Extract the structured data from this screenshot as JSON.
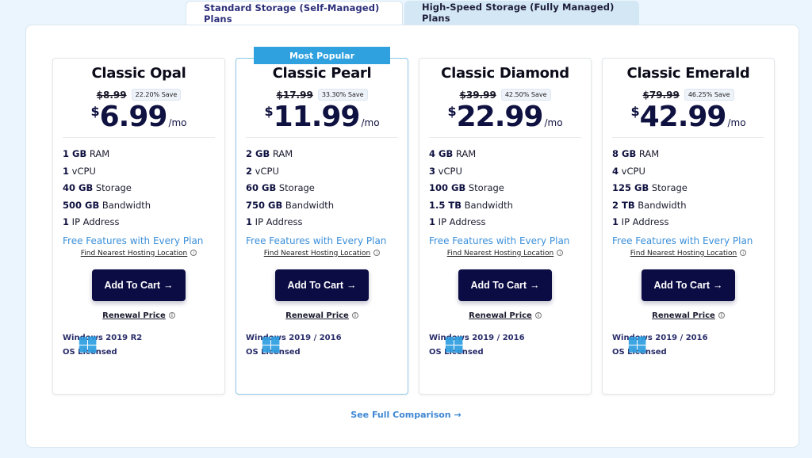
{
  "tabs": [
    {
      "label": "Standard Storage (Self-Managed) Plans",
      "active": true
    },
    {
      "label": "High-Speed Storage (Fully Managed) Plans",
      "active": false
    }
  ],
  "popular_badge": "Most Popular",
  "currency_symbol": "$",
  "per_month": "/mo",
  "free_features_label": "Free Features with Every Plan",
  "find_location_label": "Find Nearest Hosting Location",
  "add_to_cart_label": "Add To Cart",
  "add_to_cart_arrow": "→",
  "renewal_label": "Renewal Price",
  "info_icon_glyph": "i",
  "see_comparison_label": "See Full Comparison →",
  "colors": {
    "accent_blue": "#2fa1df",
    "button_navy": "#0c0c45",
    "link_blue": "#3b8fd9",
    "page_bg": "#eaf5fd"
  },
  "plans": [
    {
      "name": "Classic Opal",
      "old_price": "$8.99",
      "save": "22.20% Save",
      "price": "6.99",
      "specs": [
        {
          "bold": "1 GB",
          "text": " RAM"
        },
        {
          "bold": "1",
          "text": " vCPU"
        },
        {
          "bold": "40 GB",
          "text": " Storage"
        },
        {
          "bold": "500 GB",
          "text": " Bandwidth"
        },
        {
          "bold": "1",
          "text": " IP Address"
        }
      ],
      "os_line1": "Windows 2019 R2",
      "os_line2": "OS Licensed"
    },
    {
      "name": "Classic Pearl",
      "old_price": "$17.99",
      "save": "33.30% Save",
      "price": "11.99",
      "specs": [
        {
          "bold": "2 GB",
          "text": " RAM"
        },
        {
          "bold": "2",
          "text": " vCPU"
        },
        {
          "bold": "60 GB",
          "text": " Storage"
        },
        {
          "bold": "750 GB",
          "text": " Bandwidth"
        },
        {
          "bold": "1",
          "text": " IP Address"
        }
      ],
      "os_line1": "Windows 2019 / 2016",
      "os_line2": "OS Licensed"
    },
    {
      "name": "Classic Diamond",
      "old_price": "$39.99",
      "save": "42.50% Save",
      "price": "22.99",
      "specs": [
        {
          "bold": "4 GB",
          "text": " RAM"
        },
        {
          "bold": "3",
          "text": " vCPU"
        },
        {
          "bold": "100 GB",
          "text": " Storage"
        },
        {
          "bold": "1.5 TB",
          "text": " Bandwidth"
        },
        {
          "bold": "1",
          "text": " IP Address"
        }
      ],
      "os_line1": "Windows 2019 / 2016",
      "os_line2": "OS Licensed"
    },
    {
      "name": "Classic Emerald",
      "old_price": "$79.99",
      "save": "46.25% Save",
      "price": "42.99",
      "specs": [
        {
          "bold": "8 GB",
          "text": " RAM"
        },
        {
          "bold": "4",
          "text": " vCPU"
        },
        {
          "bold": "125 GB",
          "text": " Storage"
        },
        {
          "bold": "2 TB",
          "text": " Bandwidth"
        },
        {
          "bold": "1",
          "text": " IP Address"
        }
      ],
      "os_line1": "Windows 2019 / 2016",
      "os_line2": "OS Licensed"
    }
  ]
}
